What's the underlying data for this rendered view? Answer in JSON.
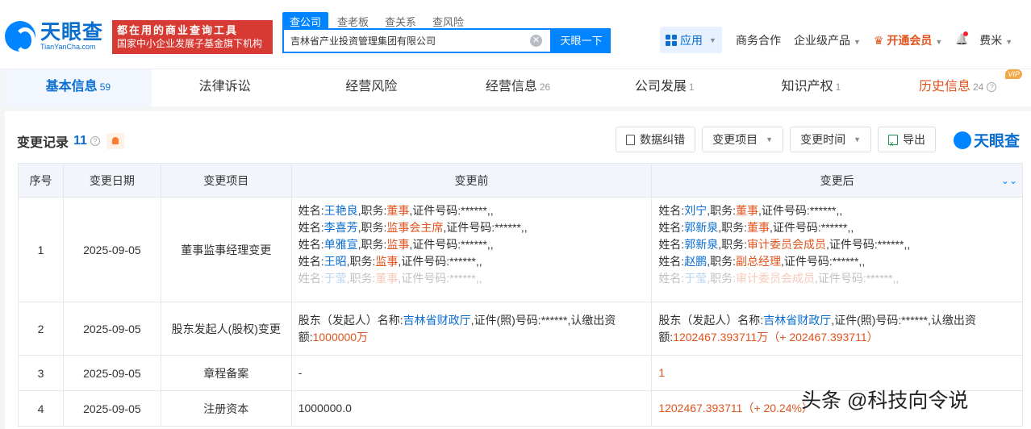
{
  "brand": {
    "name_cn": "天眼查",
    "name_en": "TianYanCha.com",
    "slogan_line1": "都在用的商业查询工具",
    "slogan_line2": "国家中小企业发展子基金旗下机构",
    "brand_color": "#0084ff"
  },
  "search": {
    "tabs": [
      "查公司",
      "查老板",
      "查关系",
      "查风险"
    ],
    "active_tab": "查公司",
    "query": "吉林省产业投资管理集团有限公司",
    "clear_icon": "✕",
    "button": "天眼一下"
  },
  "header_nav": {
    "apps": "应用",
    "business": "商务合作",
    "enterprise": "企业级产品",
    "member": "开通会员",
    "user": "费米"
  },
  "main_tabs": [
    {
      "label": "基本信息",
      "count": "59"
    },
    {
      "label": "法律诉讼",
      "count": ""
    },
    {
      "label": "经营风险",
      "count": ""
    },
    {
      "label": "经营信息",
      "count": "26"
    },
    {
      "label": "公司发展",
      "count": "1"
    },
    {
      "label": "知识产权",
      "count": "1"
    },
    {
      "label": "历史信息",
      "count": "24",
      "tag": "VIP"
    }
  ],
  "section": {
    "title": "变更记录",
    "count": "11",
    "tools": {
      "correct": "数据纠错",
      "item_filter": "变更项目",
      "time_filter": "变更时间",
      "export": "导出"
    },
    "brand": "天眼查"
  },
  "table": {
    "headers": [
      "序号",
      "变更日期",
      "变更项目",
      "变更前",
      "变更后"
    ],
    "rows": [
      {
        "no": "1",
        "date": "2025-09-05",
        "item": "董事监事经理变更",
        "before": [
          {
            "name": "王艳良",
            "role": "董事"
          },
          {
            "name": "李喜芳",
            "role": "监事会主席"
          },
          {
            "name": "单雅宣",
            "role": "监事"
          },
          {
            "name": "王昭",
            "role": "监事"
          },
          {
            "name": "于莹",
            "role": "董事"
          }
        ],
        "after": [
          {
            "name": "刘宁",
            "role": "董事"
          },
          {
            "name": "郭新泉",
            "role": "董事"
          },
          {
            "name": "郭新泉",
            "role": "审计委员会成员"
          },
          {
            "name": "赵鹏",
            "role": "副总经理"
          },
          {
            "name": "于莹",
            "role": "审计委员会成员"
          }
        ],
        "label_name": "姓名:",
        "label_role": ",职务:",
        "label_id": ",证件号码:******,,"
      },
      {
        "no": "2",
        "date": "2025-09-05",
        "item": "股东发起人(股权)变更",
        "before_prefix": "股东（发起人）名称:",
        "before_name": "吉林省财政厅",
        "before_mid": ",证件(照)号码:******,认缴出资额:",
        "before_amount": "1000000万",
        "after_prefix": "股东（发起人）名称:",
        "after_name": "吉林省财政厅",
        "after_mid": ",证件(照)号码:******,认缴出资额:",
        "after_amount": "1202467.393711万（+ 202467.393711）"
      },
      {
        "no": "3",
        "date": "2025-09-05",
        "item": "章程备案",
        "before": "-",
        "after": "1"
      },
      {
        "no": "4",
        "date": "2025-09-05",
        "item": "注册资本",
        "before": "1000000.0",
        "after": "1202467.393711（+ 20.24%）"
      }
    ]
  },
  "watermark": "头条 @科技向令说"
}
